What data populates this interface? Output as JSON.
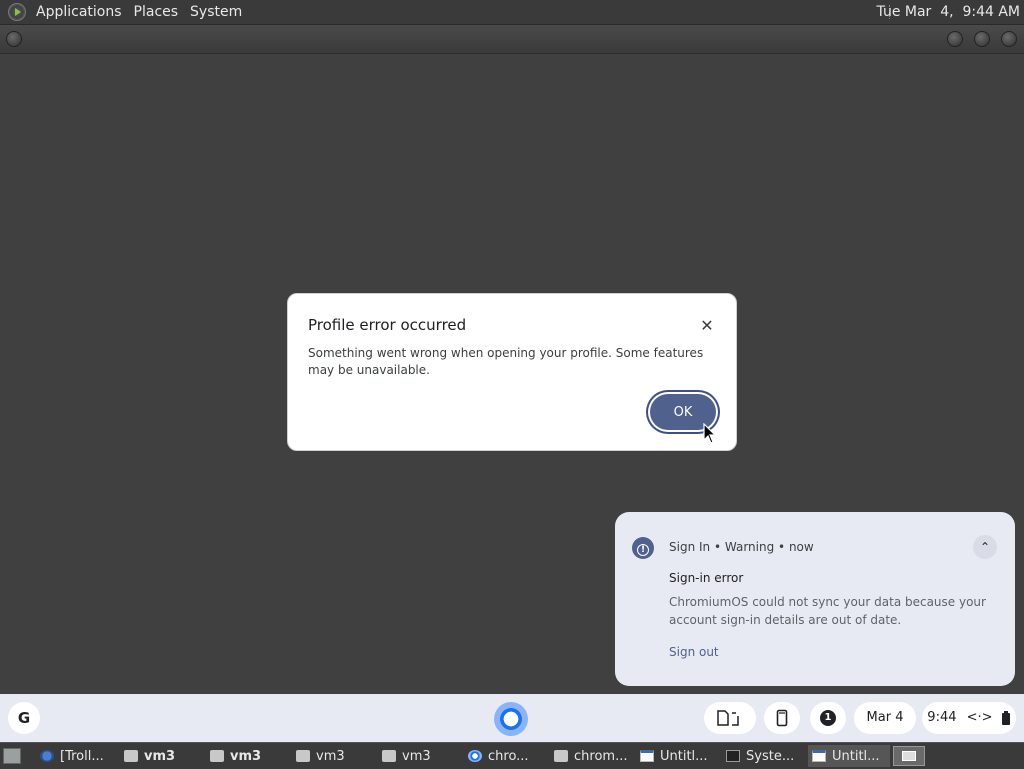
{
  "top_panel": {
    "menus": [
      "Applications",
      "Places",
      "System"
    ],
    "clock": "Tue Mar  4,  9:44 AM"
  },
  "dialog": {
    "title": "Profile error occurred",
    "message": "Something went wrong when opening your profile. Some features may be unavailable.",
    "ok_label": "OK",
    "close_icon": "close-icon"
  },
  "notification": {
    "source": "Sign In",
    "severity": "Warning",
    "time": "now",
    "meta_sep": "•",
    "title": "Sign-in error",
    "body": "ChromiumOS could not sync your data because your account sign-in details are out of date.",
    "action_label": "Sign out",
    "collapse_glyph": "⌃",
    "icon": "warning-icon"
  },
  "shelf": {
    "launcher_label": "G",
    "tray": {
      "notification_count": "1",
      "date": "Mar 4",
      "time": "9:44",
      "network_glyph": "<·>"
    }
  },
  "taskbar": {
    "tasks": [
      {
        "label": "[Troll...",
        "icon": "firefox-icon",
        "bold": false
      },
      {
        "label": "vm3",
        "icon": "folder-icon",
        "bold": true
      },
      {
        "label": "vm3",
        "icon": "folder-icon",
        "bold": true
      },
      {
        "label": "vm3",
        "icon": "folder-icon",
        "bold": false
      },
      {
        "label": "vm3",
        "icon": "folder-icon",
        "bold": false
      },
      {
        "label": "chro...",
        "icon": "chrome-icon",
        "bold": false
      },
      {
        "label": "chrom...",
        "icon": "folder-icon",
        "bold": false
      },
      {
        "label": "Untitl...",
        "icon": "window-icon",
        "bold": false
      },
      {
        "label": "Syste...",
        "icon": "monitor-icon",
        "bold": false
      },
      {
        "label": "Untitl...",
        "icon": "window-icon",
        "bold": false
      }
    ]
  }
}
